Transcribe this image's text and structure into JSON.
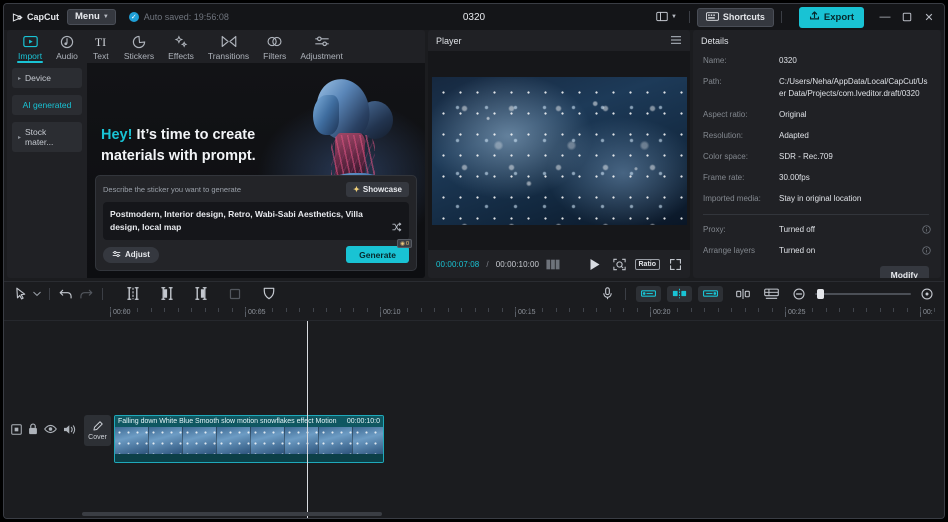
{
  "titlebar": {
    "brand": "CapCut",
    "menu_label": "Menu",
    "autosave": "Auto saved: 19:56:08",
    "project_title": "0320",
    "layout_icon": "layout-icon",
    "shortcuts_label": "Shortcuts",
    "export_label": "Export",
    "minimize": "—",
    "maximize": "❐",
    "close": "✕"
  },
  "left_panel": {
    "tabs": [
      {
        "label": "Import",
        "icon": "import-icon",
        "active": true
      },
      {
        "label": "Audio",
        "icon": "audio-icon",
        "active": false
      },
      {
        "label": "Text",
        "icon": "text-icon",
        "active": false
      },
      {
        "label": "Stickers",
        "icon": "stickers-icon",
        "active": false
      },
      {
        "label": "Effects",
        "icon": "effects-icon",
        "active": false
      },
      {
        "label": "Transitions",
        "icon": "transitions-icon",
        "active": false
      },
      {
        "label": "Filters",
        "icon": "filters-icon",
        "active": false
      },
      {
        "label": "Adjustment",
        "icon": "adjustment-icon",
        "active": false
      }
    ],
    "side_items": [
      {
        "label": "Device",
        "active": false
      },
      {
        "label": "AI generated",
        "active": true
      },
      {
        "label": "Stock mater...",
        "active": false
      }
    ],
    "hero": {
      "highlight": "Hey!",
      "text": "It’s time to create materials with prompt."
    },
    "prompt": {
      "label": "Describe the sticker you want to generate",
      "showcase_label": "Showcase",
      "value": "Postmodern, Interior design, Retro, Wabi-Sabi Aesthetics, Villa design, local map",
      "adjust_label": "Adjust",
      "generate_label": "Generate",
      "credit_badge": "0"
    }
  },
  "player": {
    "title": "Player",
    "menu_icon": "hamburger-icon",
    "current_time": "00:00:07:08",
    "separator": "/",
    "total_time": "00:00:10:00",
    "grid_icon": "filmstrip-icon",
    "play_icon": "play-icon",
    "focus_icon": "focus-icon",
    "ratio_label": "Ratio",
    "fullscreen_icon": "fullscreen-icon"
  },
  "details": {
    "title": "Details",
    "rows": [
      {
        "key": "Name:",
        "value": "0320",
        "info": false
      },
      {
        "key": "Path:",
        "value": "C:/Users/Neha/AppData/Local/CapCut/User Data/Projects/com.lveditor.draft/0320",
        "info": false
      },
      {
        "key": "Aspect ratio:",
        "value": "Original",
        "info": false
      },
      {
        "key": "Resolution:",
        "value": "Adapted",
        "info": false
      },
      {
        "key": "Color space:",
        "value": "SDR - Rec.709",
        "info": false
      },
      {
        "key": "Frame rate:",
        "value": "30.00fps",
        "info": false
      },
      {
        "key": "Imported media:",
        "value": "Stay in original location",
        "info": false
      }
    ],
    "rows_after_sep": [
      {
        "key": "Proxy:",
        "value": "Turned off",
        "info": true
      },
      {
        "key": "Arrange layers",
        "value": "Turned on",
        "info": true
      }
    ],
    "modify_label": "Modify"
  },
  "timeline": {
    "tools_left": [
      {
        "name": "select-tool",
        "icon": "cursor-icon",
        "state": "on"
      },
      {
        "name": "select-dropdown",
        "icon": "chevron-down-icon",
        "state": "on"
      },
      {
        "name": "undo-button",
        "icon": "undo-icon",
        "state": "on"
      },
      {
        "name": "redo-button",
        "icon": "redo-icon",
        "state": "dim"
      },
      {
        "name": "split-button",
        "icon": "split-icon",
        "state": "on"
      },
      {
        "name": "trim-left-button",
        "icon": "trim-left-icon",
        "state": "on"
      },
      {
        "name": "trim-right-button",
        "icon": "trim-right-icon",
        "state": "on"
      },
      {
        "name": "delete-button",
        "icon": "delete-icon",
        "state": "dim"
      },
      {
        "name": "mask-button",
        "icon": "mask-icon",
        "state": "on"
      }
    ],
    "tools_right": [
      {
        "name": "record-voiceover-button",
        "icon": "microphone-icon"
      },
      {
        "name": "link-clip-button",
        "icon": "clip-link-icon"
      },
      {
        "name": "mirror-clip-button",
        "icon": "clip-mirror-icon"
      },
      {
        "name": "unlink-clip-button",
        "icon": "clip-unlink-icon"
      },
      {
        "name": "split-sync-button",
        "icon": "split-sync-icon"
      },
      {
        "name": "track-layout-button",
        "icon": "track-layout-icon"
      },
      {
        "name": "zoom-out-button",
        "icon": "zoom-out-icon"
      },
      {
        "name": "fit-timeline-button",
        "icon": "fit-icon"
      }
    ],
    "ruler_labels": [
      "00:00",
      "00:05",
      "00:10",
      "00:15",
      "00:20",
      "00:25",
      "00:"
    ],
    "playhead_time": "00:00:07:08",
    "track_controls": [
      {
        "name": "track-frame-toggle",
        "icon": "frame-icon"
      },
      {
        "name": "track-lock-toggle",
        "icon": "lock-icon"
      },
      {
        "name": "track-visibility-toggle",
        "icon": "eye-icon"
      },
      {
        "name": "track-mute-toggle",
        "icon": "volume-icon"
      }
    ],
    "cover_label": "Cover",
    "clip": {
      "title": "Falling down White Blue Smooth slow motion  snowflakes effect  Motion",
      "duration": "00:00:10:0"
    }
  },
  "colors": {
    "accent": "#19c3d4",
    "panel": "#202125",
    "window": "#1b1c1f",
    "clip": "#0f5761"
  }
}
